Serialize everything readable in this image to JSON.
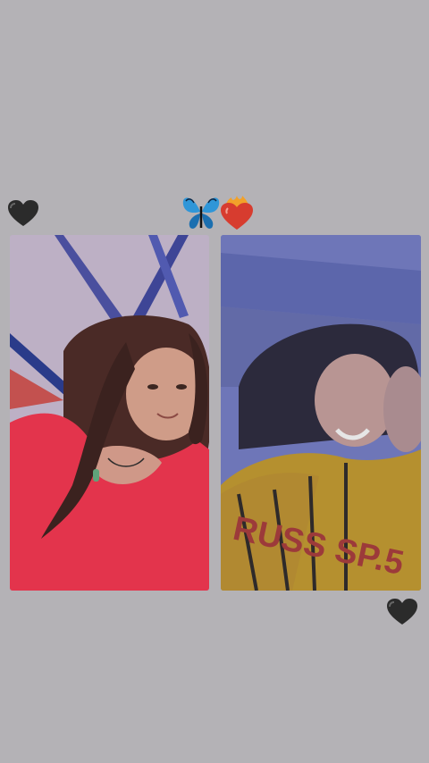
{
  "icons": {
    "top_left": "black-heart-icon",
    "center": [
      "butterfly-icon",
      "heart-on-fire-icon"
    ],
    "bottom_right": "black-heart-icon"
  },
  "photos": {
    "left": {
      "visible_text": ""
    },
    "right": {
      "visible_text": "RUSS SP.5"
    }
  },
  "colors": {
    "background": "#b4b2b6",
    "left_photo_accent": "#d9384f",
    "right_photo_accent": "#c59e3d",
    "butterfly": "#2f96d8",
    "flame_heart": "#d73c2f"
  }
}
